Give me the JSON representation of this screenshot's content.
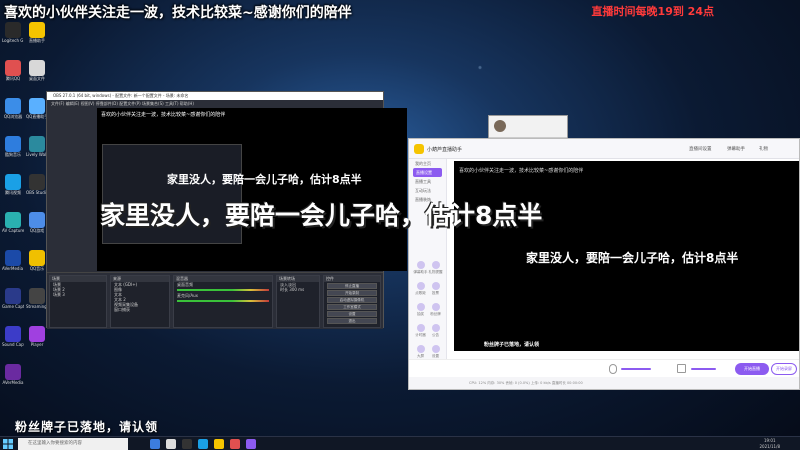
{
  "overlay": {
    "top_text": "喜欢的小伙伴关注走一波，技术比较菜~感谢你们的陪伴",
    "time_text": "直播时间每晚19到 24点",
    "main_caption": "家里没人，要陪一会儿子哈，估计8点半",
    "bottom_text": "粉丝牌子已落地，请认领"
  },
  "desktop_icons": [
    {
      "label": "Logitech G HUB",
      "color": "#2a2a2a"
    },
    {
      "label": "直播助手",
      "color": "#f5c400"
    },
    {
      "label": "腾讯QQ",
      "color": "#e05050"
    },
    {
      "label": "桌面文件",
      "color": "#d8d8d8"
    },
    {
      "label": "QQ浏览器",
      "color": "#3b8de8"
    },
    {
      "label": "QQ直播助手",
      "color": "#5ab0ff"
    },
    {
      "label": "酷狗音乐",
      "color": "#2e7dde"
    },
    {
      "label": "Lively Wallpaper",
      "color": "#2b8a9e"
    },
    {
      "label": "腾讯视频",
      "color": "#1aa0e6"
    },
    {
      "label": "OBS Studio",
      "color": "#333"
    },
    {
      "label": "AV Capture",
      "color": "#2ab0b0"
    },
    {
      "label": "QQ游戏",
      "color": "#4d8de8"
    },
    {
      "label": "AVerMedia RECentral",
      "color": "#1b4aa8"
    },
    {
      "label": "QQ音乐",
      "color": "#f0c000"
    },
    {
      "label": "Game Capture",
      "color": "#2a3a8a"
    },
    {
      "label": "Streaming Tool",
      "color": "#444"
    },
    {
      "label": "Sound Capture",
      "color": "#3c3cc8"
    },
    {
      "label": "Player",
      "color": "#a040e0"
    },
    {
      "label": "AVerMedia",
      "color": "#6a2aa0"
    }
  ],
  "obs": {
    "title": "OBS 27.0.1 (64 bit, windows) - 配置文件: 新一个配置文件 - 场景: 未命名",
    "menu": "文件(F)  编辑(E)  视图(V)  停靠部件(D)  配置文件(P)  场景集合(S)  工具(T)  帮助(H)",
    "preview_caption_top": "喜欢的小伙伴关注走一波，技术比较菜~感谢你们的陪伴",
    "preview_caption_mid": "家里没人，要陪一会儿子哈，估计8点半",
    "panels": {
      "scenes": {
        "header": "场景",
        "rows": [
          "场景",
          "场景 2",
          "场景 3"
        ]
      },
      "sources": {
        "header": "来源",
        "rows": [
          "文本 (GDI+)",
          "图像",
          "文本",
          "文本 2",
          "视频采集设备",
          "窗口捕获"
        ]
      },
      "mixer": {
        "header": "混音器",
        "rows": [
          "桌面音频",
          "麦克风/Aux"
        ]
      },
      "transitions": {
        "header": "场景转场",
        "rows": [
          "淡入淡出",
          "时长 300 ms"
        ]
      },
      "controls": {
        "header": "控件",
        "buttons": [
          "停止直播",
          "开始录制",
          "启动虚拟摄像机",
          "工作室模式",
          "设置",
          "退出"
        ]
      }
    }
  },
  "app": {
    "title": "小葫芦直播助手",
    "tabs": [
      "直播间设置",
      "弹幕助手",
      "礼物"
    ],
    "sidebar": {
      "items": [
        "我的主页",
        "直播设置",
        "直播工具",
        "互动玩法",
        "直播装饰"
      ],
      "active_index": 1,
      "grid": [
        "弹幕助手",
        "礼物提醒",
        "点歌姬",
        "投票",
        "抽奖",
        "粉丝牌",
        "计时器",
        "公告",
        "大屏",
        "设置"
      ]
    },
    "video_caption_top": "喜欢的小伙伴关注走一波，技术比较菜~感谢你们的陪伴",
    "video_caption_mid": "家里没人，要陪一会儿子哈，估计8点半",
    "video_caption_bottom": "粉丝牌子已落地，请认领",
    "start_button": "开始直播",
    "record_button": "开始录屏",
    "status": "CPU: 12%   内存: 30%   丢帧: 0 (0.0%)   上传: 0 kb/s   直播时长 00:00:00",
    "mic_level": 0.6,
    "speaker_level": 0.5
  },
  "taskbar": {
    "search_placeholder": "在这里输入你要搜索的内容",
    "clock_time": "19:01",
    "clock_date": "2021/11/8"
  }
}
